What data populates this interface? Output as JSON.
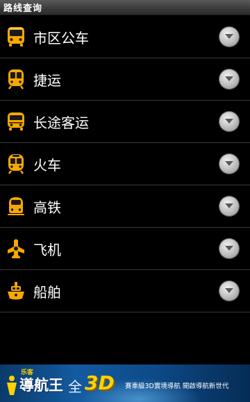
{
  "app": {
    "title": "路线查询"
  },
  "list": {
    "items": [
      {
        "label": "市区公车",
        "icon": "bus-icon"
      },
      {
        "label": "捷运",
        "icon": "metro-icon"
      },
      {
        "label": "长途客运",
        "icon": "coach-icon"
      },
      {
        "label": "火车",
        "icon": "train-icon"
      },
      {
        "label": "高铁",
        "icon": "high-speed-rail-icon"
      },
      {
        "label": "飞机",
        "icon": "airplane-icon"
      },
      {
        "label": "船舶",
        "icon": "ship-icon"
      }
    ],
    "expand_icon": "chevron-down-icon"
  },
  "banner": {
    "brand_sub": "乐客",
    "brand": "導航王",
    "quan": "全",
    "threed": "3D",
    "tagline": "賽車級3D實境導航  開啟導航新世代"
  },
  "colors": {
    "background": "#000000",
    "icon_orange": "#f7a800",
    "divider": "#3a3a3a"
  }
}
